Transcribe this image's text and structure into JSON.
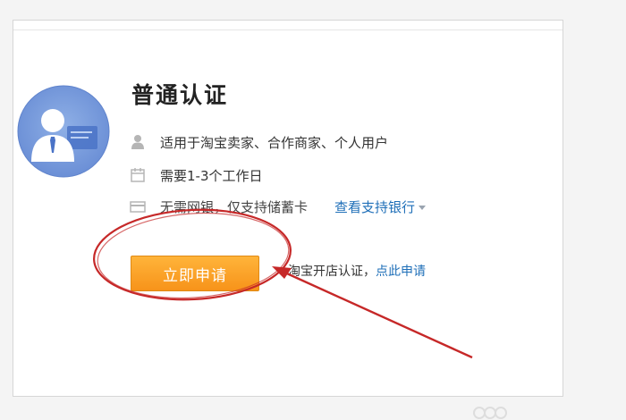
{
  "card": {
    "title": "普通认证",
    "rows": [
      {
        "icon": "person-icon",
        "text": "适用于淘宝卖家、合作商家、个人用户"
      },
      {
        "icon": "calendar-icon",
        "text": "需要1-3个工作日"
      },
      {
        "icon": "card-icon",
        "text": "无需网银，仅支持储蓄卡",
        "link": "查看支持银行"
      }
    ],
    "apply_button": "立即申请",
    "shop_note": "淘宝开店认证，",
    "shop_link": "点此申请"
  },
  "annotation": {
    "ellipse_color": "#c62828",
    "arrow_color": "#c62828"
  },
  "colors": {
    "accent": "#f7931a",
    "link": "#1f6fb8"
  }
}
